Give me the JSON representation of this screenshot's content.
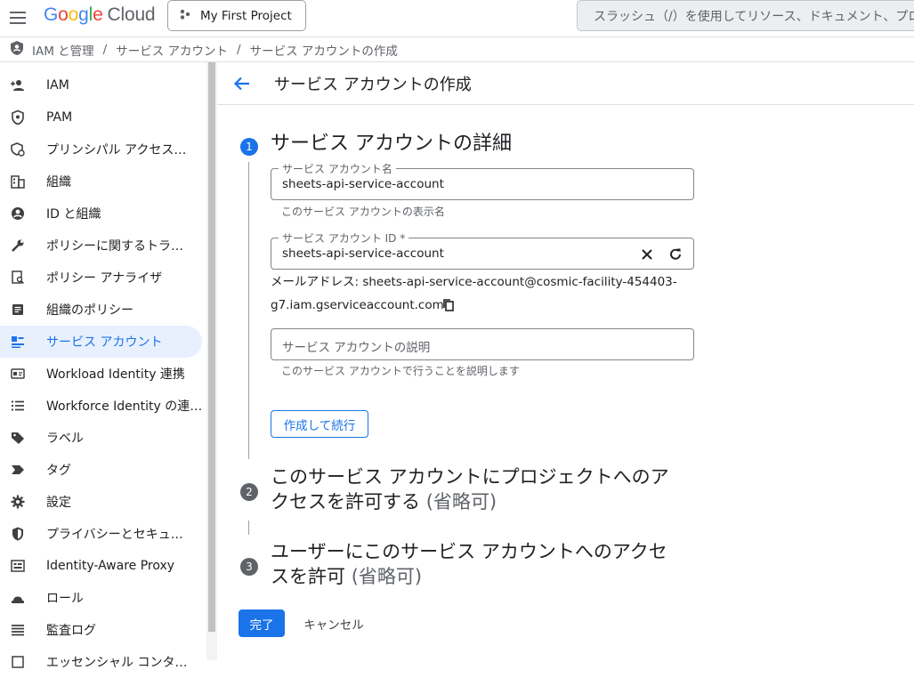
{
  "topbar": {
    "logo_google": [
      "G",
      "o",
      "o",
      "g",
      "l",
      "e"
    ],
    "logo_cloud": "Cloud",
    "project": "My First Project",
    "search_placeholder": "スラッシュ（/）を使用してリソース、ドキュメント、プロダクトなどを検索"
  },
  "breadcrumb": {
    "items": [
      "IAM と管理",
      "サービス アカウント",
      "サービス アカウントの作成"
    ],
    "separator": "/"
  },
  "sidebar": {
    "items": [
      {
        "label": "IAM",
        "icon": "person-add-icon"
      },
      {
        "label": "PAM",
        "icon": "shield-icon"
      },
      {
        "label": "プリンシパル アクセス…",
        "icon": "principal-access-icon"
      },
      {
        "label": "組織",
        "icon": "building-icon"
      },
      {
        "label": "ID と組織",
        "icon": "account-circle-icon"
      },
      {
        "label": "ポリシーに関するトラ…",
        "icon": "wrench-icon"
      },
      {
        "label": "ポリシー アナライザ",
        "icon": "policy-analyzer-icon"
      },
      {
        "label": "組織のポリシー",
        "icon": "article-icon"
      },
      {
        "label": "サービス アカウント",
        "icon": "service-account-icon",
        "active": true
      },
      {
        "label": "Workload Identity 連携",
        "icon": "id-card-icon"
      },
      {
        "label": "Workforce Identity の連…",
        "icon": "list-icon"
      },
      {
        "label": "ラベル",
        "icon": "label-icon"
      },
      {
        "label": "タグ",
        "icon": "tag-icon"
      },
      {
        "label": "設定",
        "icon": "gear-icon"
      },
      {
        "label": "プライバシーとセキュ…",
        "icon": "privacy-shield-icon"
      },
      {
        "label": "Identity-Aware Proxy",
        "icon": "proxy-icon"
      },
      {
        "label": "ロール",
        "icon": "role-icon"
      },
      {
        "label": "監査ログ",
        "icon": "audit-log-icon"
      },
      {
        "label": "エッセンシャル コンタ…",
        "icon": "contacts-icon"
      }
    ]
  },
  "main": {
    "title": "サービス アカウントの作成",
    "steps": [
      {
        "number": "1",
        "title": "サービス アカウントの詳細",
        "optional": ""
      },
      {
        "number": "2",
        "title_line1": "このサービス アカウントにプロジェクトへのア",
        "title_line2": "クセスを許可する",
        "optional": "(省略可)"
      },
      {
        "number": "3",
        "title_line1": "ユーザーにこのサービス アカウントへのアクセ",
        "title_line2": "スを許可",
        "optional": "(省略可)"
      }
    ],
    "fields": {
      "name_label": "サービス アカウント名",
      "name_value": "sheets-api-service-account",
      "name_hint": "このサービス アカウントの表示名",
      "id_label": "サービス アカウント ID *",
      "id_value": "sheets-api-service-account",
      "email_line1": "メールアドレス: sheets-api-service-account@cosmic-facility-454403-",
      "email_line2": "g7.iam.gserviceaccount.com",
      "desc_placeholder": "サービス アカウントの説明",
      "desc_hint": "このサービス アカウントで行うことを説明します"
    },
    "buttons": {
      "create_continue": "作成して続行",
      "done": "完了",
      "cancel": "キャンセル"
    }
  },
  "colors": {
    "accent": "#1a73e8",
    "step_active": "#1a73e8",
    "step_inactive": "#5f6368",
    "sidebar_active_bg": "#e8f0fe"
  }
}
